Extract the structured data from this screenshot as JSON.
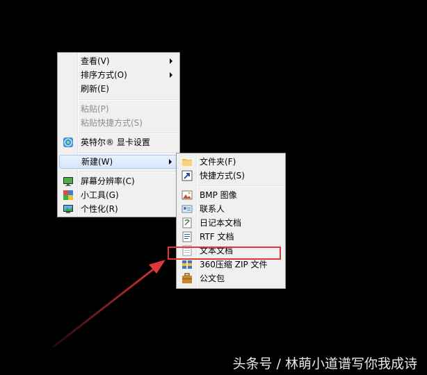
{
  "context_menu": {
    "items": [
      {
        "label": "查看(V)"
      },
      {
        "label": "排序方式(O)"
      },
      {
        "label": "刷新(E)"
      },
      {
        "label": "粘贴(P)"
      },
      {
        "label": "粘贴快捷方式(S)"
      },
      {
        "label": "英特尔® 显卡设置",
        "icon": "intel-graphics-icon"
      },
      {
        "label": "新建(W)"
      },
      {
        "label": "屏幕分辨率(C)",
        "icon": "display-icon"
      },
      {
        "label": "小工具(G)",
        "icon": "gadgets-icon"
      },
      {
        "label": "个性化(R)",
        "icon": "personalize-icon"
      }
    ]
  },
  "new_submenu": {
    "items": [
      {
        "label": "文件夹(F)",
        "icon": "folder-icon"
      },
      {
        "label": "快捷方式(S)",
        "icon": "shortcut-icon"
      },
      {
        "label": "BMP 图像",
        "icon": "bitmap-icon"
      },
      {
        "label": "联系人",
        "icon": "contact-icon"
      },
      {
        "label": "日记本文档",
        "icon": "journal-icon"
      },
      {
        "label": "RTF 文档",
        "icon": "rtf-document-icon"
      },
      {
        "label": "文本文档",
        "icon": "text-document-icon"
      },
      {
        "label": "360压缩 ZIP 文件",
        "icon": "zip-archive-icon"
      },
      {
        "label": "公文包",
        "icon": "briefcase-icon"
      }
    ]
  },
  "annotation": {
    "highlight_color": "#e0383a"
  },
  "watermark": "头条号 / 林萌小道谱写你我成诗"
}
